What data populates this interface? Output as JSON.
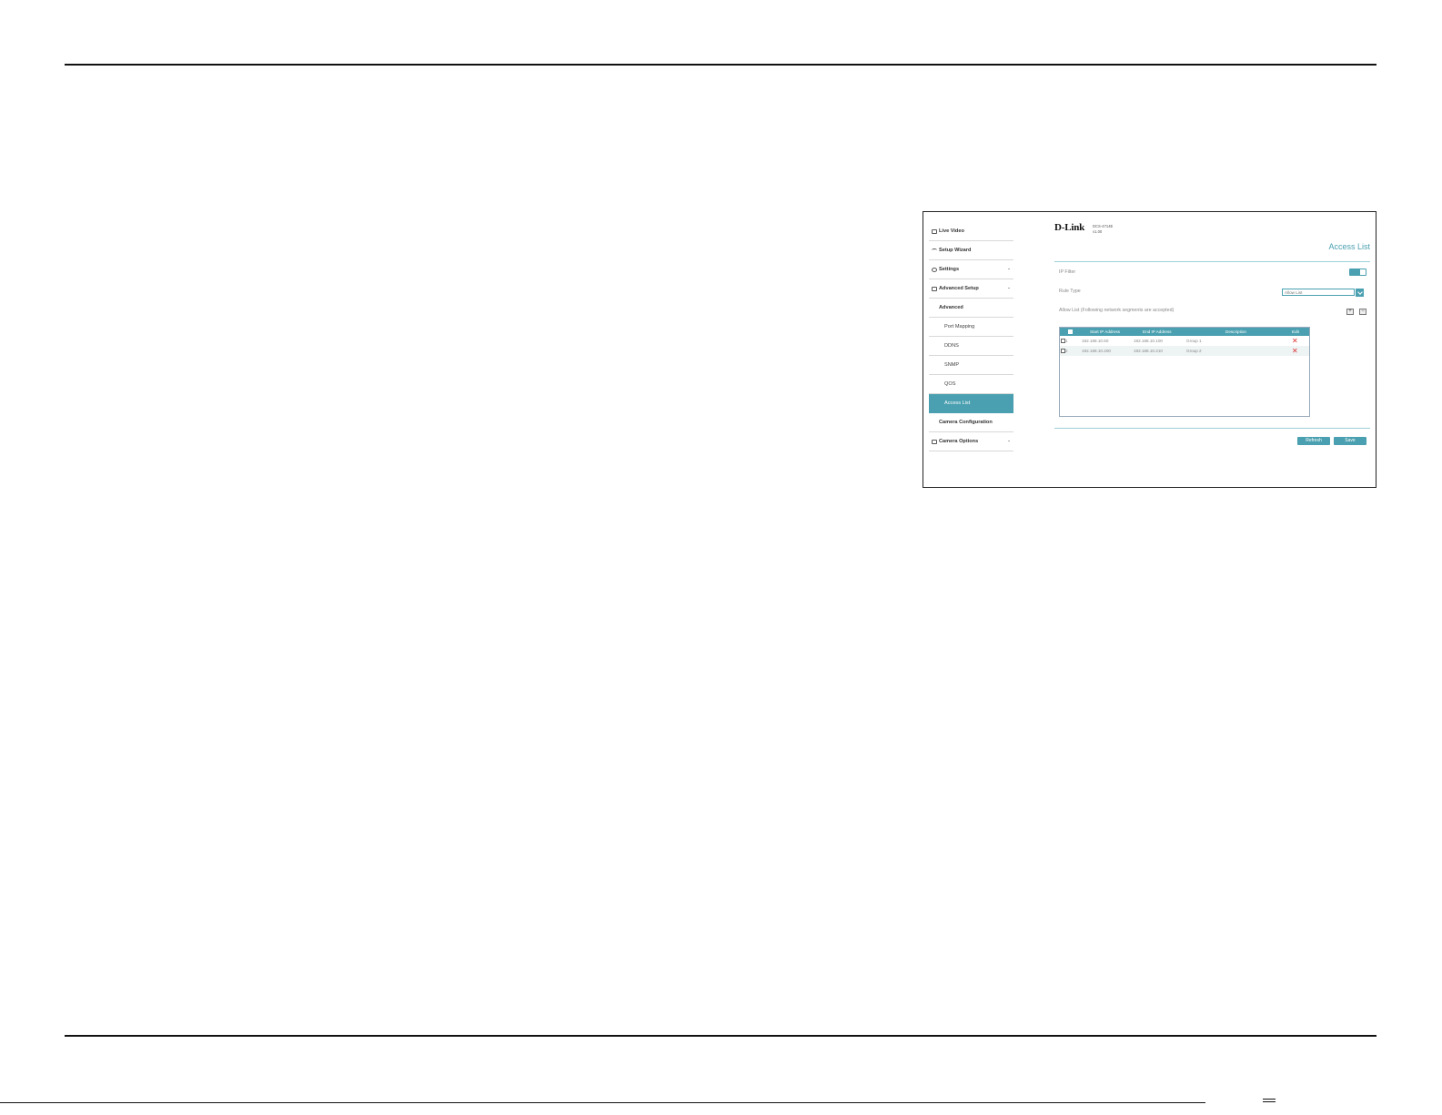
{
  "app": {
    "brand": "D-Link",
    "model": "DCS-4714E",
    "version": "v1.00"
  },
  "sidebar": {
    "items": [
      {
        "label": "Live Video",
        "icon": "video-icon"
      },
      {
        "label": "Setup Wizard",
        "icon": "wizard-icon"
      },
      {
        "label": "Settings",
        "icon": "gear-icon"
      },
      {
        "label": "Advanced Setup",
        "icon": "advanced-icon"
      },
      {
        "label": "Advanced"
      },
      {
        "label": "Port Mapping"
      },
      {
        "label": "DDNS"
      },
      {
        "label": "SNMP"
      },
      {
        "label": "QOS"
      },
      {
        "label": "Access List"
      },
      {
        "label": "Camera Configuration"
      },
      {
        "label": "Camera Options",
        "icon": "camera-options-icon"
      }
    ],
    "active": "Access List",
    "accent_color": "#4aa0b0"
  },
  "main": {
    "title": "Access List",
    "ip_filter": {
      "label": "IP Filter",
      "enabled": true
    },
    "rule_type": {
      "label": "Rule Type",
      "value": "Allow List"
    },
    "allow_list_label": "Allow List (Following network segments are accepted)",
    "table": {
      "headers": [
        "Start IP Address",
        "End IP Address",
        "Description",
        "Edit"
      ],
      "rows": [
        {
          "num": "1",
          "start": "192.168.10.50",
          "end": "192.168.10.100",
          "desc": "Group 1"
        },
        {
          "num": "2",
          "start": "192.168.10.200",
          "end": "192.168.10.210",
          "desc": "Group 2"
        }
      ]
    },
    "buttons": {
      "refresh": "Refresh",
      "save": "Save"
    }
  }
}
